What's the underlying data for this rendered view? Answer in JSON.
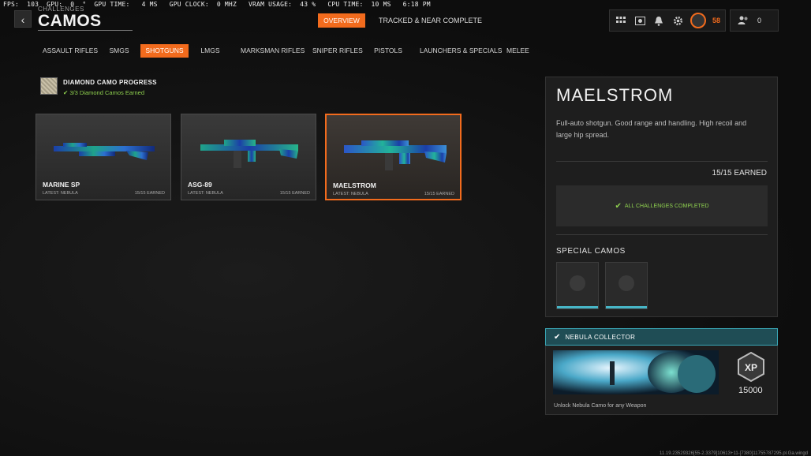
{
  "osd": "FPS:  103  GPU:  0  °  GPU TIME:   4 MS   GPU CLOCK:  0 MHZ   VRAM USAGE:  43 %   CPU TIME:  10 MS   6:18 PM",
  "header": {
    "back_symbol": "‹",
    "crumb": "CHALLENGES",
    "title": "CAMOS",
    "tabs": [
      "OVERVIEW",
      "TRACKED & NEAR COMPLETE"
    ],
    "level": "58",
    "friends_count": "0"
  },
  "categories": [
    {
      "label": "ASSAULT RIFLES",
      "active": false
    },
    {
      "label": "SMGS",
      "active": false
    },
    {
      "label": "SHOTGUNS",
      "active": true
    },
    {
      "label": "LMGS",
      "active": false
    },
    {
      "label": "MARKSMAN RIFLES",
      "active": false
    },
    {
      "label": "SNIPER RIFLES",
      "active": false
    },
    {
      "label": "PISTOLS",
      "active": false
    },
    {
      "label": "LAUNCHERS & SPECIALS",
      "active": false
    },
    {
      "label": "MELEE",
      "active": false
    }
  ],
  "progress": {
    "title": "DIAMOND CAMO PROGRESS",
    "subtitle": "3/3 Diamond Camos Earned"
  },
  "weapons": [
    {
      "name": "MARINE SP",
      "latest": "LATEST: NEBULA",
      "earned": "15/15 EARNED",
      "selected": false
    },
    {
      "name": "ASG-89",
      "latest": "LATEST: NEBULA",
      "earned": "15/15 EARNED",
      "selected": false
    },
    {
      "name": "MAELSTROM",
      "latest": "LATEST: NEBULA",
      "earned": "15/15 EARNED",
      "selected": true
    }
  ],
  "detail": {
    "title": "MAELSTROM",
    "description": "Full-auto shotgun.  Good range and handling. High recoil and large hip spread.",
    "earned": "15/15 EARNED",
    "challenges": "ALL CHALLENGES COMPLETED",
    "special_title": "SPECIAL CAMOS"
  },
  "reward": {
    "title": "NEBULA COLLECTOR",
    "xp": "15000",
    "description": "Unlock Nebula Camo for any Weapon"
  },
  "footer": "11.19.23529326[55-2.3379]10613+11-[7380]11755787295.pl.Ga.wingd"
}
